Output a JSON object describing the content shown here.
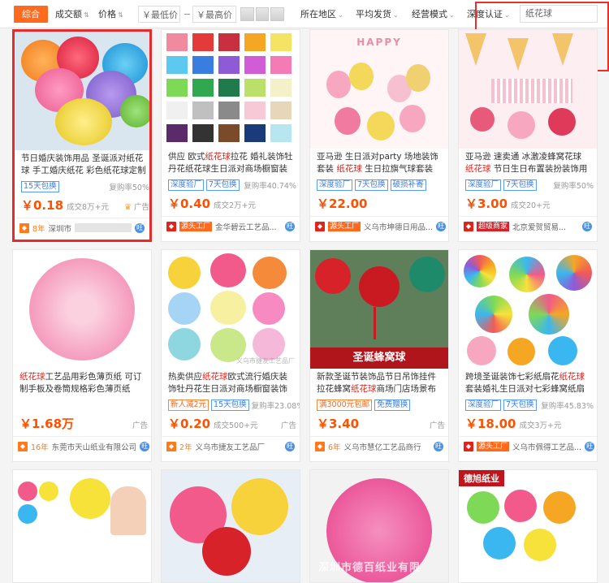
{
  "filters": {
    "active": "综合",
    "sales": "成交额",
    "price": "价格",
    "min_price": "￥最低价",
    "max_price": "￥最高价",
    "region": "所在地区",
    "ship": "平均发货",
    "mode": "经营模式",
    "certify": "深度认证",
    "search_value": "纸花球"
  },
  "products": [
    {
      "title_pre": "节日婚庆装饰用品 圣诞派对纸花球 手工婚庆纸花 彩色纸花球定制",
      "kw": "",
      "title_post": "",
      "tags": [
        "15天包换"
      ],
      "rate": "复购率50%",
      "price": "￥0.18",
      "sold": "成交8万+元",
      "ad": "广告",
      "years": "8年",
      "seller": "深圳市"
    },
    {
      "title_pre": "供应 欧式",
      "kw": "纸花球",
      "title_post": "拉花 婚礼装饰牡丹花纸花球生日派对商场橱窗装饰",
      "tags": [
        "深度验厂",
        "7天包换"
      ],
      "rate": "复购率40.74%",
      "price": "￥0.40",
      "sold": "成交2万+元",
      "ad": "",
      "years": "",
      "seller": "金华碧云工艺品..."
    },
    {
      "title_pre": "亚马逊 生日派对party 场地装饰套装 ",
      "kw": "纸花球",
      "title_post": " 生日拉旗气球套装",
      "tags": [
        "深度验厂",
        "7天包换",
        "破损补寄"
      ],
      "rate": "",
      "price": "￥22.00",
      "sold": "",
      "ad": "",
      "years": "",
      "seller": "义乌市坤德日用品..."
    },
    {
      "title_pre": "亚马逊 速卖通 冰激凌蜂窝花球 ",
      "kw": "纸花球",
      "title_post": " 节日生日布置装扮装饰用品",
      "tags": [
        "深度验厂",
        "7天包换"
      ],
      "rate": "复购率50%",
      "price": "￥3.00",
      "sold": "成交20+元",
      "ad": "",
      "years": "",
      "seller": "北京爱贺贸易..."
    },
    {
      "title_pre": "",
      "kw": "纸花球",
      "title_post": "工艺品用彩色薄页纸 可订制手板及卷筒规格彩色薄页纸",
      "tags": [],
      "rate": "",
      "price": "￥1.68万",
      "sold": "",
      "ad": "广告",
      "years": "16年",
      "seller": "东莞市天山纸业有限公司"
    },
    {
      "title_pre": "热卖供应",
      "kw": "纸花球",
      "title_post": "欧式流行婚庆装饰牡丹花生日派对商场橱窗装饰",
      "tags": [
        "新人减2元",
        "15天包换"
      ],
      "rate": "复购率23.08%",
      "price": "￥0.20",
      "sold": "成交500+元",
      "ad": "广告",
      "years": "2年",
      "seller": "义乌市捷友工艺品厂"
    },
    {
      "title_pre": "新款圣诞节装饰品节日吊饰挂件拉花蜂窝",
      "kw": "纸花球",
      "title_post": "商场门店场景布置",
      "tags": [
        "满3000元包邮",
        "免费赠换"
      ],
      "rate": "",
      "price": "￥3.40",
      "sold": "",
      "ad": "广告",
      "years": "6年",
      "seller": "义乌市慧亿工艺品商行"
    },
    {
      "title_pre": "跨境圣诞装饰七彩纸扇花",
      "kw": "纸花球",
      "title_post": "套装婚礼生日派对七彩蜂窝纸扇套装",
      "tags": [
        "深度验厂",
        "7天包换"
      ],
      "rate": "复购率45.83%",
      "price": "￥18.00",
      "sold": "成交3万+元",
      "ad": "",
      "years": "",
      "seller": "义乌市佩得工艺品..."
    }
  ],
  "labels": {
    "source_factory": "源头工厂",
    "hot_cert": "超级商家",
    "ww": "旺",
    "honeycomb_banner": "圣诞蜂窝球",
    "bottom_watermark": "深圳市德百纸业有限",
    "card_watermark": "义乌市捷友工艺品厂",
    "paper_banner": "德旭纸业"
  },
  "colors": {
    "accent": "#ff6a1e",
    "price": "#ff5000",
    "highlight": "#e52b2b",
    "tag_blue": "#3a7de0"
  }
}
